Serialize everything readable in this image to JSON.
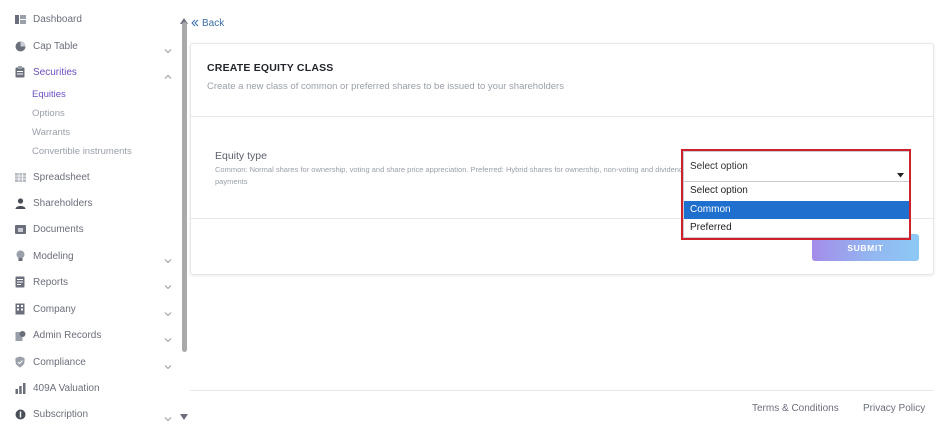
{
  "sidebar": {
    "items": [
      {
        "label": "Dashboard",
        "icon": "dashboard-icon"
      },
      {
        "label": "Cap Table",
        "icon": "pie-chart-icon",
        "has_chevron": true
      },
      {
        "label": "Securities",
        "icon": "clipboard-icon",
        "has_chevron": true,
        "expanded": true,
        "active": true
      },
      {
        "label": "Spreadsheet",
        "icon": "spreadsheet-icon"
      },
      {
        "label": "Shareholders",
        "icon": "user-icon"
      },
      {
        "label": "Documents",
        "icon": "folder-icon"
      },
      {
        "label": "Modeling",
        "icon": "lightbulb-icon",
        "has_chevron": true
      },
      {
        "label": "Reports",
        "icon": "reports-icon",
        "has_chevron": true
      },
      {
        "label": "Company",
        "icon": "building-icon",
        "has_chevron": true
      },
      {
        "label": "Admin Records",
        "icon": "admin-records-icon",
        "has_chevron": true
      },
      {
        "label": "Compliance",
        "icon": "shield-icon",
        "has_chevron": true
      },
      {
        "label": "409A Valuation",
        "icon": "bar-chart-icon"
      },
      {
        "label": "Subscription",
        "icon": "subscription-icon",
        "has_chevron": true
      }
    ],
    "securities_subitems": [
      {
        "label": "Equities",
        "active": true
      },
      {
        "label": "Options"
      },
      {
        "label": "Warrants"
      },
      {
        "label": "Convertible instruments"
      }
    ]
  },
  "back": {
    "label": "Back"
  },
  "card": {
    "title": "CREATE EQUITY CLASS",
    "subtitle": "Create a new class of common or preferred shares to be issued to your shareholders",
    "field": {
      "label": "Equity type",
      "help": "Common: Normal shares for ownership, voting and share price appreciation. Preferred: Hybrid shares for ownership, non-voting and dividend payments",
      "select_value": "Select option",
      "options": [
        "Select option",
        "Common",
        "Preferred"
      ],
      "highlighted_option": "Common"
    },
    "submit_label": "SUBMIT"
  },
  "footer": {
    "terms": "Terms & Conditions",
    "privacy": "Privacy Policy"
  },
  "colors": {
    "accent": "#6b4fbf",
    "link": "#3a6ea5",
    "highlight_option": "#1f6fcf",
    "annotation_frame": "#d0202a"
  }
}
